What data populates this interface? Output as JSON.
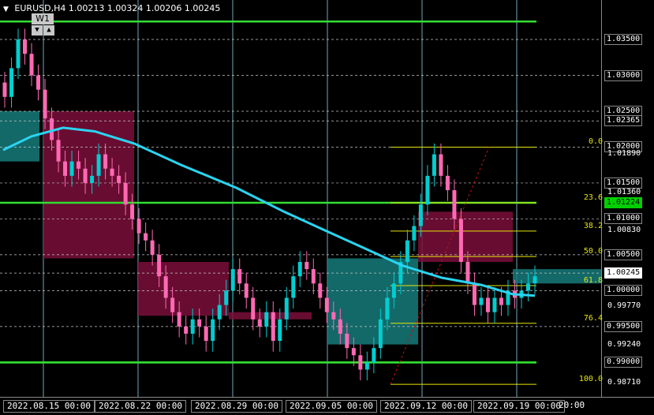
{
  "header": {
    "symbol": "EURUSD,H4",
    "open": "1.00213",
    "high": "1.00324",
    "low": "1.00206",
    "close": "1.00245",
    "timeframe": "W1"
  },
  "colors": {
    "background": "#000000",
    "bull_candle": "#00ced1",
    "bear_candle": "#ff69b4",
    "ma": "#2ad4f0",
    "fib": "#e6e60a",
    "green_level": "#33dd33",
    "supply_zone": "#7a0f3a",
    "demand_zone": "#167a7a"
  },
  "price_axis": [
    {
      "value": "1.03500",
      "style": "box"
    },
    {
      "value": "1.03000",
      "style": "box"
    },
    {
      "value": "1.02500",
      "style": "box"
    },
    {
      "value": "1.02365",
      "style": "box"
    },
    {
      "value": "1.02000",
      "style": "box"
    },
    {
      "value": "1.01890",
      "style": "plain"
    },
    {
      "value": "1.01500",
      "style": "box"
    },
    {
      "value": "1.01360",
      "style": "plain"
    },
    {
      "value": "1.01224",
      "style": "green"
    },
    {
      "value": "1.01000",
      "style": "box"
    },
    {
      "value": "1.00830",
      "style": "plain"
    },
    {
      "value": "1.00500",
      "style": "box"
    },
    {
      "value": "1.00245",
      "style": "white"
    },
    {
      "value": "1.00000",
      "style": "box"
    },
    {
      "value": "0.99770",
      "style": "plain"
    },
    {
      "value": "0.99500",
      "style": "box"
    },
    {
      "value": "0.99240",
      "style": "plain"
    },
    {
      "value": "0.99000",
      "style": "box"
    },
    {
      "value": "0.98710",
      "style": "plain"
    }
  ],
  "time_axis": [
    {
      "label": "2022.08.15 00:00"
    },
    {
      "label": "2022.08.22 00:00"
    },
    {
      "label": "2022.08.29 00:00"
    },
    {
      "label": "2022.09.05 00:00"
    },
    {
      "label": "2022.09.12 00:00"
    },
    {
      "label": "2022.09.19 00:00"
    },
    {
      "label": "20:00"
    }
  ],
  "fib_levels": [
    {
      "label": "0.0",
      "price": 1.02
    },
    {
      "label": "23.6",
      "price": 1.01224
    },
    {
      "label": "38.2",
      "price": 1.0083
    },
    {
      "label": "50.0",
      "price": 1.00475
    },
    {
      "label": "61.8",
      "price": 1.0007
    },
    {
      "label": "76.4",
      "price": 0.99545
    },
    {
      "label": "100.0",
      "price": 0.98695
    }
  ],
  "chart_data": {
    "type": "candlestick",
    "symbol": "EURUSD",
    "timeframe": "H4",
    "ylim": [
      0.9852,
      1.0405
    ],
    "horizontal_levels": [
      1.0375,
      1.035,
      1.03,
      1.025,
      1.02365,
      1.02,
      1.015,
      1.01224,
      1.01,
      1.005,
      1.00245,
      1.0,
      0.995,
      0.99,
      0.99
    ],
    "green_levels": [
      1.0375,
      1.01224,
      0.99
    ],
    "last_price": 1.00245,
    "closes": [
      1.027,
      1.031,
      1.035,
      1.033,
      1.03,
      1.028,
      1.024,
      1.021,
      1.018,
      1.016,
      1.018,
      1.017,
      1.015,
      1.016,
      1.019,
      1.017,
      1.016,
      1.015,
      1.012,
      1.01,
      1.008,
      1.007,
      1.005,
      1.002,
      0.999,
      0.997,
      0.995,
      0.994,
      0.996,
      0.995,
      0.993,
      0.996,
      0.998,
      1.0,
      1.003,
      1.001,
      0.999,
      0.996,
      0.995,
      0.997,
      0.993,
      0.996,
      0.999,
      1.002,
      1.004,
      1.003,
      1.001,
      0.999,
      0.997,
      0.996,
      0.994,
      0.992,
      0.991,
      0.989,
      0.99,
      0.992,
      0.996,
      0.999,
      1.001,
      1.004,
      1.007,
      1.009,
      1.012,
      1.016,
      1.019,
      1.016,
      1.014,
      1.01,
      1.004,
      1.001,
      0.998,
      0.999,
      0.997,
      0.999,
      0.998,
      1.0,
      0.999,
      1.0,
      1.001,
      1.002
    ]
  }
}
